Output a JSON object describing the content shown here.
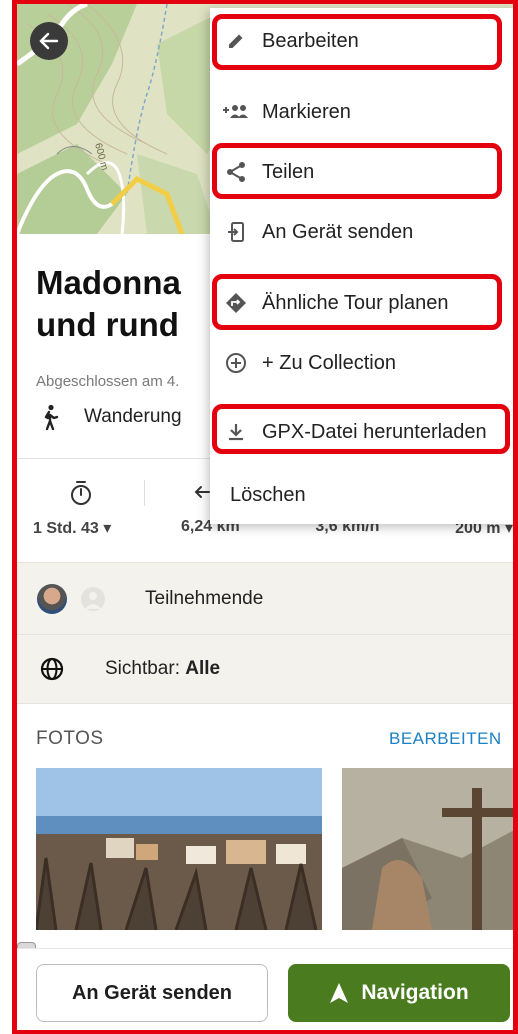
{
  "tour": {
    "title_line1": "Madonna",
    "title_line2": "und rund",
    "completed_text": "Abgeschlossen am 4.",
    "type_label": "Wanderung"
  },
  "stats": [
    {
      "value": "1 Std. 43 ▾",
      "icon": "stopwatch-icon"
    },
    {
      "value": "6,24 km",
      "icon": "arrow-icon"
    },
    {
      "value": "3,6 km/h",
      "icon": "speed-icon"
    },
    {
      "value": "200 m ▾",
      "icon": "elevation-icon"
    }
  ],
  "participants": {
    "label": "Teilnehmende"
  },
  "visibility": {
    "prefix": "Sichtbar: ",
    "value": "Alle"
  },
  "photos": {
    "header": "FOTOS",
    "edit_label": "BEARBEITEN"
  },
  "map": {
    "contour_label": "600 m"
  },
  "menu": {
    "items": [
      {
        "label": "Bearbeiten",
        "icon": "pencil-icon",
        "highlighted": true
      },
      {
        "label": "Markieren",
        "icon": "add-people-icon",
        "highlighted": false
      },
      {
        "label": "Teilen",
        "icon": "share-icon",
        "highlighted": true
      },
      {
        "label": "An Gerät senden",
        "icon": "send-to-device-icon",
        "highlighted": false
      },
      {
        "label": "Ähnliche Tour planen",
        "icon": "route-diamond-icon",
        "highlighted": true
      },
      {
        "label": "+ Zu Collection",
        "icon": "plus-circle-icon",
        "highlighted": false
      },
      {
        "label": "GPX-Datei herunterladen",
        "icon": "download-icon",
        "highlighted": true
      },
      {
        "label": "Löschen",
        "icon": "",
        "highlighted": false
      }
    ]
  },
  "bottom": {
    "send_label": "An Gerät senden",
    "nav_label": "Navigation"
  },
  "colors": {
    "annotation_red": "#e3000f",
    "navigation_green": "#4a7c1f",
    "link_blue": "#1b80c4",
    "zoom_pink": "#f27aa7"
  }
}
